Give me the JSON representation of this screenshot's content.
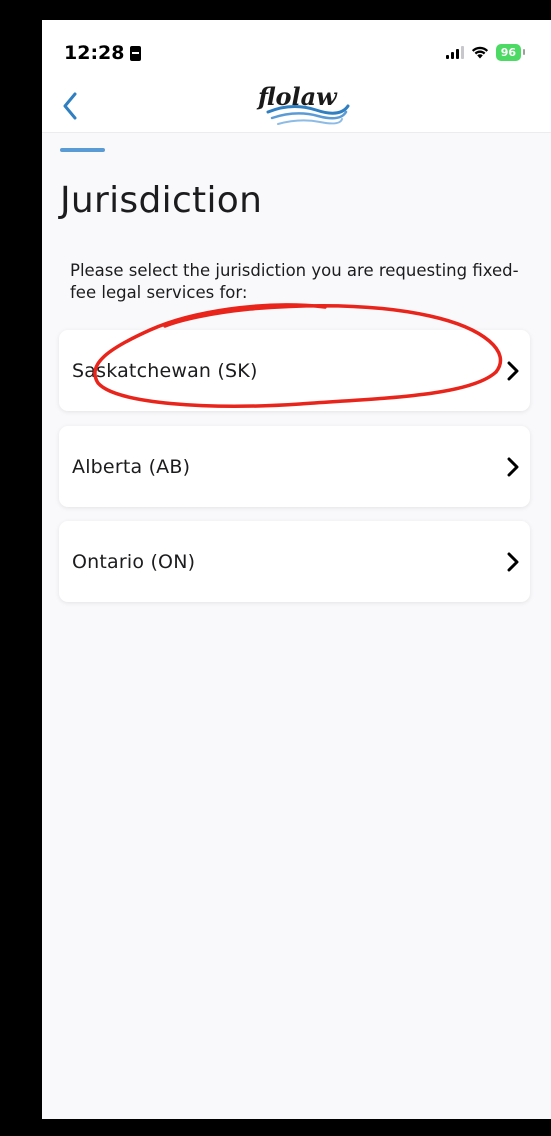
{
  "status_bar": {
    "time": "12:28",
    "battery_percent": "96",
    "icons": [
      "focus-icon",
      "signal-icon",
      "wifi-icon",
      "battery-icon"
    ],
    "battery_color": "#4cd964"
  },
  "nav": {
    "back_icon": "chevron-left-icon",
    "logo_text": "flolaw",
    "accent_color": "#2f7fc1"
  },
  "page": {
    "title": "Jurisdiction",
    "instruction": "Please select the jurisdiction you are requesting fixed-fee legal services for:",
    "progress_color": "#5b9bd5"
  },
  "options": [
    {
      "label": "Saskatchewan (SK)",
      "icon": "chevron-right-icon"
    },
    {
      "label": "Alberta (AB)",
      "icon": "chevron-right-icon"
    },
    {
      "label": "Ontario (ON)",
      "icon": "chevron-right-icon"
    }
  ],
  "annotation": {
    "shape": "freehand-circle",
    "color": "#e8241b",
    "target": "Saskatchewan (SK)"
  }
}
